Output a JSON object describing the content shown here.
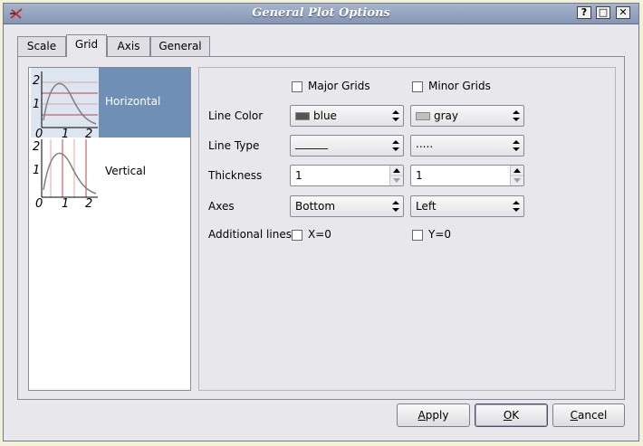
{
  "window": {
    "title": "General Plot Options",
    "controls": {
      "help": "?",
      "maximize": "□",
      "close": "✕"
    },
    "app_icon": "scidavis-icon"
  },
  "tabs": [
    {
      "label": "Scale",
      "active": false
    },
    {
      "label": "Grid",
      "active": true
    },
    {
      "label": "Axis",
      "active": false
    },
    {
      "label": "General",
      "active": false
    }
  ],
  "axis_list": {
    "items": [
      {
        "label": "Horizontal",
        "selected": true,
        "icon": "horizontal-grid-icon",
        "tick_labels": {
          "x": [
            "0",
            "1",
            "2"
          ],
          "y": [
            "2",
            "1"
          ]
        }
      },
      {
        "label": "Vertical",
        "selected": false,
        "icon": "vertical-grid-icon",
        "tick_labels": {
          "x": [
            "0",
            "1",
            "2"
          ],
          "y": [
            "2",
            "1"
          ]
        }
      }
    ]
  },
  "grid": {
    "major_label": "Major Grids",
    "minor_label": "Minor Grids",
    "major_checked": false,
    "minor_checked": false,
    "line_color_label": "Line Color",
    "major_color": "blue",
    "minor_color": "gray",
    "major_color_hex": "#555555",
    "minor_color_hex": "#c0c0c0",
    "line_type_label": "Line Type",
    "major_line_type": "______",
    "minor_line_type": ".....",
    "thickness_label": "Thickness",
    "major_thickness": "1",
    "minor_thickness": "1",
    "axes_label": "Axes",
    "major_axis": "Bottom",
    "minor_axis": "Left",
    "additional_label": "Additional lines",
    "x0_label": "X=0",
    "y0_label": "Y=0",
    "x0_checked": false,
    "y0_checked": false
  },
  "buttons": {
    "apply_prefix": "A",
    "apply_rest": "pply",
    "ok_prefix": "O",
    "ok_rest": "K",
    "cancel_prefix": "C",
    "cancel_rest": "ancel"
  }
}
